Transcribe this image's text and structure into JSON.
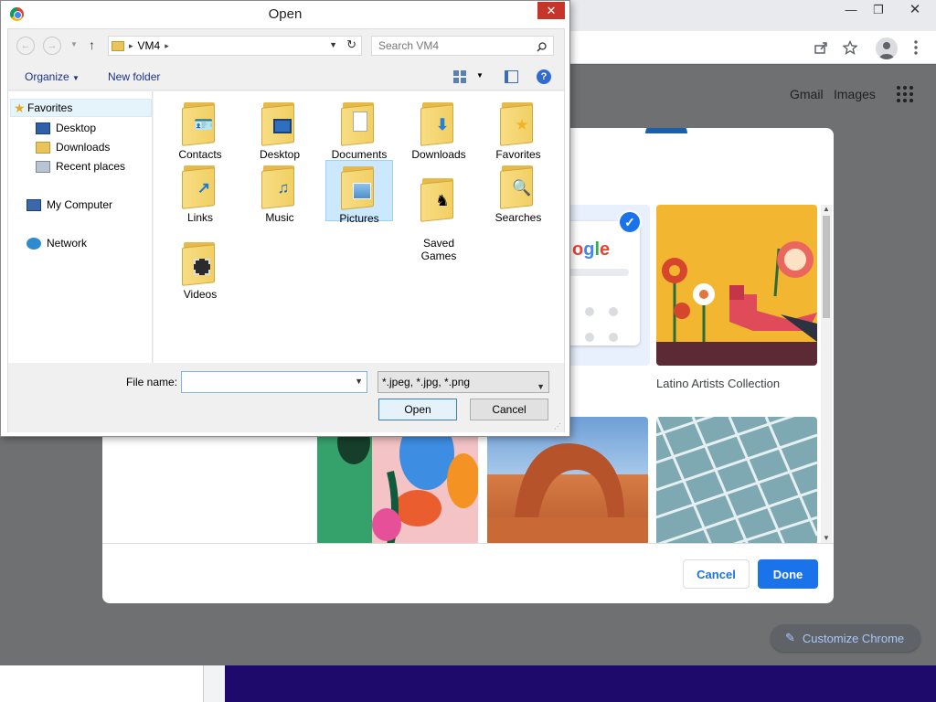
{
  "chrome": {
    "header_links": {
      "gmail": "Gmail",
      "images": "Images"
    },
    "customize_button": "Customize Chrome",
    "window_controls": {
      "minimize": "—",
      "restore": "❐",
      "close": "✕"
    }
  },
  "customize_dialog": {
    "tiles": [
      {
        "name": "Google",
        "selected": true
      },
      {
        "name": "Latino Artists Collection"
      }
    ],
    "cancel_label": "Cancel",
    "done_label": "Done",
    "colors": {
      "accent": "#1a73e8"
    }
  },
  "open_dialog": {
    "title": "Open",
    "breadcrumb": "VM4",
    "search_placeholder": "Search VM4",
    "toolbar": {
      "organize": "Organize",
      "new_folder": "New folder"
    },
    "nav": {
      "favorites": "Favorites",
      "desktop": "Desktop",
      "downloads": "Downloads",
      "recent_places": "Recent places",
      "my_computer": "My Computer",
      "network": "Network"
    },
    "folders": [
      {
        "label": "Contacts",
        "icon": "contact-card-icon"
      },
      {
        "label": "Desktop",
        "icon": "monitor-icon"
      },
      {
        "label": "Documents",
        "icon": "document-icon"
      },
      {
        "label": "Downloads",
        "icon": "download-arrow-icon"
      },
      {
        "label": "Favorites",
        "icon": "star-icon"
      },
      {
        "label": "Links",
        "icon": "link-arrow-icon"
      },
      {
        "label": "Music",
        "icon": "music-note-icon"
      },
      {
        "label": "Pictures",
        "icon": "picture-icon",
        "selected": true
      },
      {
        "label": "Saved\nGames",
        "icon": "chess-piece-icon"
      },
      {
        "label": "Searches",
        "icon": "magnifier-icon"
      },
      {
        "label": "Videos",
        "icon": "film-icon"
      }
    ],
    "file_name_label": "File name:",
    "file_name_value": "",
    "file_type": "*.jpeg, *.jpg, *.png",
    "open_label": "Open",
    "cancel_label": "Cancel"
  }
}
